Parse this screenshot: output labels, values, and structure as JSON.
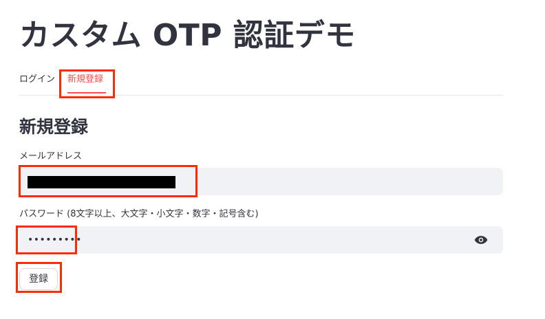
{
  "app": {
    "title": "カスタム OTP 認証デモ"
  },
  "tabs": [
    {
      "label": "ログイン",
      "selected": false
    },
    {
      "label": "新規登録",
      "selected": true
    }
  ],
  "form": {
    "heading": "新規登録",
    "email_label": "メールアドレス",
    "email_value": "",
    "password_label": "パスワード (8文字以上、大文字・小文字・数字・記号含む)",
    "password_value": "•••••••••",
    "password_toggle_icon": "eye-icon",
    "submit_label": "登録"
  },
  "colors": {
    "accent": "#ff4b4b",
    "annotation": "#ff2a00",
    "input_bg": "#f0f2f6",
    "text": "#31333f"
  }
}
